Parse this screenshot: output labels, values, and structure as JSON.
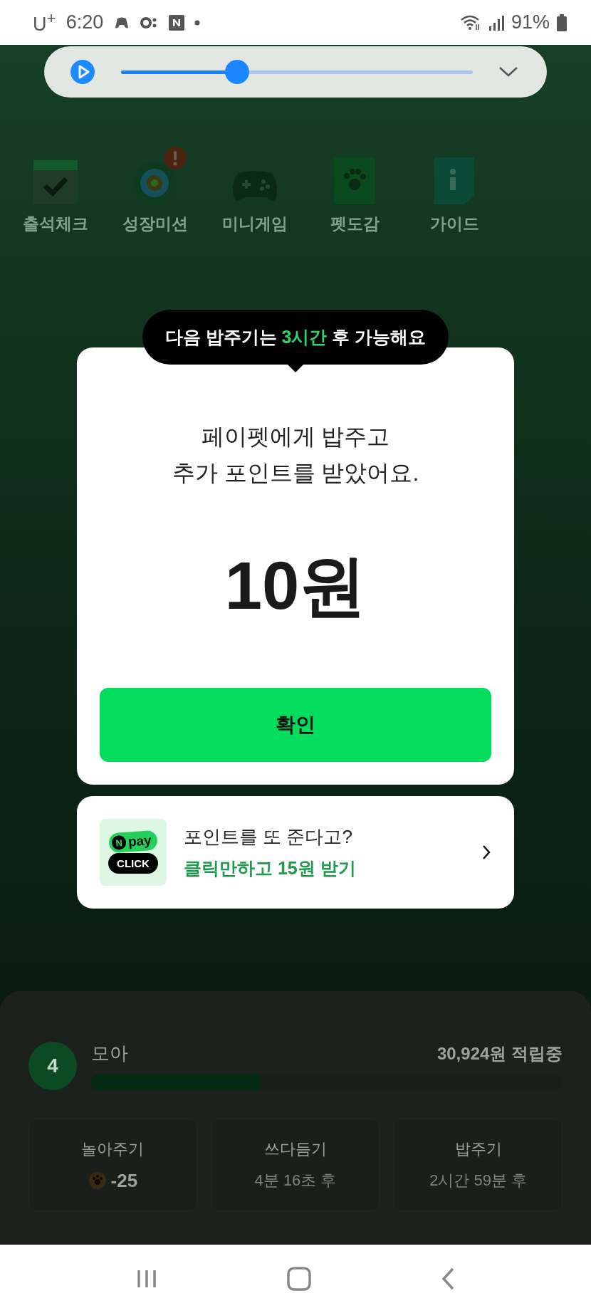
{
  "status_bar": {
    "carrier": "U$^{+}$",
    "time": "6:20",
    "battery": "91%"
  },
  "media_player": {
    "level": 0.33
  },
  "menu": [
    {
      "label": "출석체크",
      "kind": "calendar",
      "alert": false
    },
    {
      "label": "성장미션",
      "kind": "target",
      "alert": true
    },
    {
      "label": "미니게임",
      "kind": "gamepad",
      "alert": false
    },
    {
      "label": "펫도감",
      "kind": "book",
      "alert": false
    },
    {
      "label": "가이드",
      "kind": "guide",
      "alert": false
    }
  ],
  "tooltip": {
    "text": "다음 밥주기는 **3시간** 후 가능해요"
  },
  "dialog": {
    "message": "페이펫에게 밥주고\n추가 포인트를 받았어요.",
    "amount": "10원",
    "confirm": "확인"
  },
  "ad": {
    "logo_n": "N",
    "logo_pay": "pay",
    "logo_click": "CLICK",
    "title": "포인트를 또 준다고?",
    "subtitle": "클릭만하고 15원 받기"
  },
  "pet": {
    "badge": "4",
    "name": "모아",
    "savings": "30,924원 적립중",
    "progress": {
      "level": 0.36
    }
  },
  "actions": [
    {
      "label": "놀아주기",
      "value": "-25",
      "kind": "count"
    },
    {
      "label": "쓰다듬기",
      "value": "4분 16초 후",
      "kind": "timer"
    },
    {
      "label": "밥주기",
      "value": "2시간 59분 후",
      "kind": "timer"
    }
  ]
}
